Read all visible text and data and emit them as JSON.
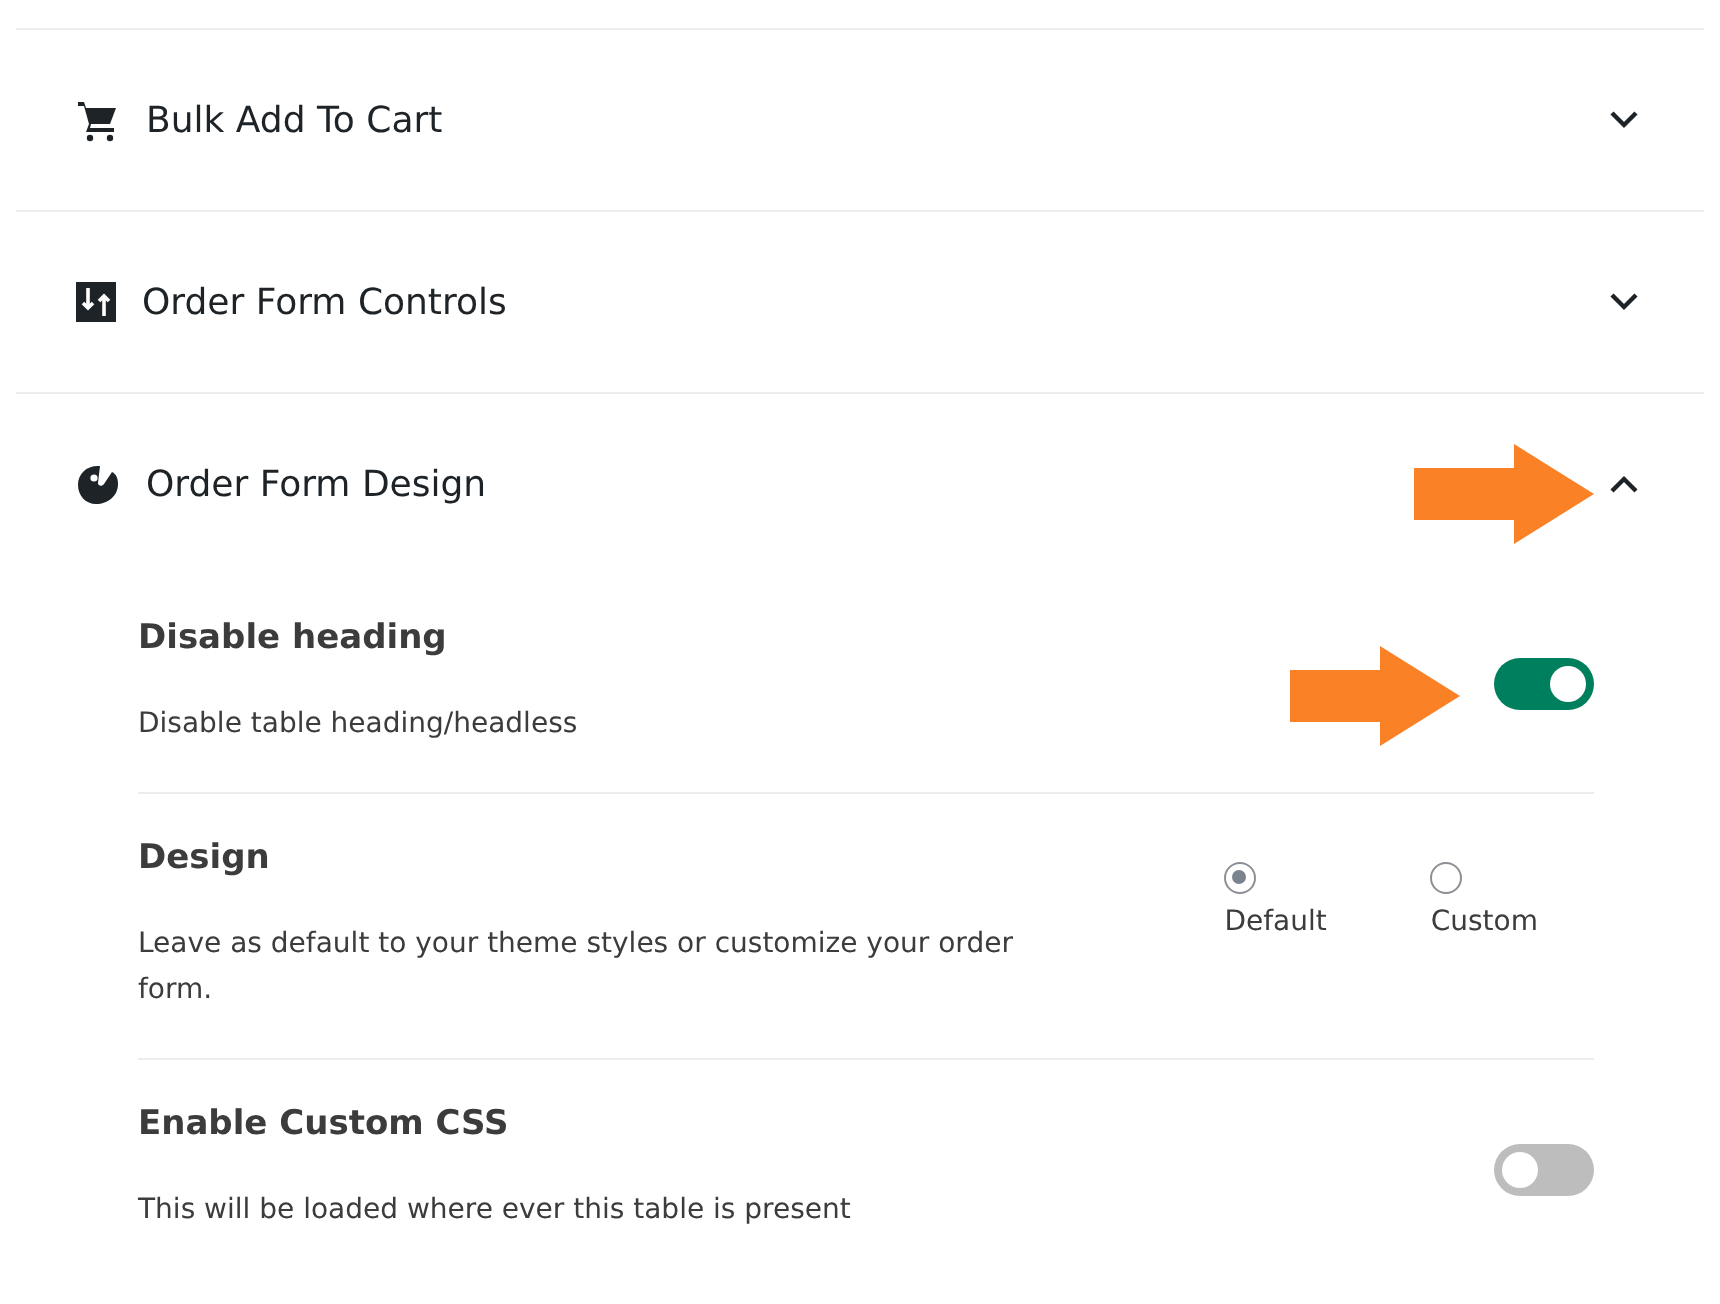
{
  "sections": [
    {
      "title": "Bulk Add To Cart",
      "kind": "cart",
      "expanded": false
    },
    {
      "title": "Order Form Controls",
      "kind": "sliders",
      "expanded": false
    },
    {
      "title": "Order Form Design",
      "kind": "palette",
      "expanded": true,
      "settings": [
        {
          "kind": "toggle",
          "label": "Disable heading",
          "description": "Disable table heading/headless",
          "on": true
        },
        {
          "kind": "radio",
          "label": "Design",
          "description": "Leave as default to your theme styles or customize your order form.",
          "options": [
            {
              "label": "Default",
              "selected": true
            },
            {
              "label": "Custom",
              "selected": false
            }
          ]
        },
        {
          "kind": "toggle",
          "label": "Enable Custom CSS",
          "description": "This will be loaded where ever this table is present",
          "on": false
        }
      ]
    }
  ]
}
